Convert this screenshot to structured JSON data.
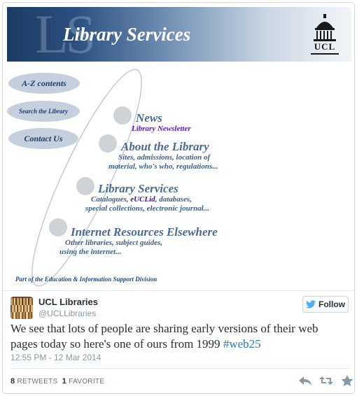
{
  "old_page": {
    "banner_watermark": "LS",
    "banner_title": "Library Services",
    "logo_text": "UCL",
    "nav": {
      "az": "A-Z contents",
      "search": "Search the Library",
      "contact": "Contact Us"
    },
    "sections": {
      "news": {
        "title": "News",
        "sub": "Library Newsletter"
      },
      "about": {
        "title": "About the Library",
        "line1": "Sites, admissions, location of",
        "line2": "material, who's who, regulations..."
      },
      "services": {
        "title": "Library Services",
        "line1_a": "Catalogues, ",
        "line1_hl": "eUCLid",
        "line1_b": ", databases,",
        "line2": "special collections, electronic journal..."
      },
      "internet": {
        "title": "Internet Resources Elsewhere",
        "line1": "Other libraries, subject guides,",
        "line2": "using the internet..."
      }
    },
    "footer_note": "Part of the Education & Information Support Division"
  },
  "tweet": {
    "user_name": "UCL Libraries",
    "handle": "@UCLLibraries",
    "follow_label": "Follow",
    "text_line1": "We see that lots of people are sharing early versions of their web",
    "text_line2": "pages today so here's one of ours from 1999 ",
    "hashtag": "#web25",
    "timestamp": "12:55 PM - 12 Mar 2014",
    "retweets_count": "8",
    "retweets_label": "RETWEETS",
    "favorites_count": "1",
    "favorites_label": "FAVORITE"
  },
  "colors": {
    "banner_dark": "#1c3b63",
    "link_blue": "#2b7bb9",
    "pill": "#c4d0de",
    "newsletter_purple": "#5a16c8"
  },
  "icons": [
    "ucl-portico-icon",
    "orbit-bullet-icon",
    "twitter-bird-icon",
    "reply-icon",
    "retweet-icon",
    "favorite-star-icon"
  ]
}
